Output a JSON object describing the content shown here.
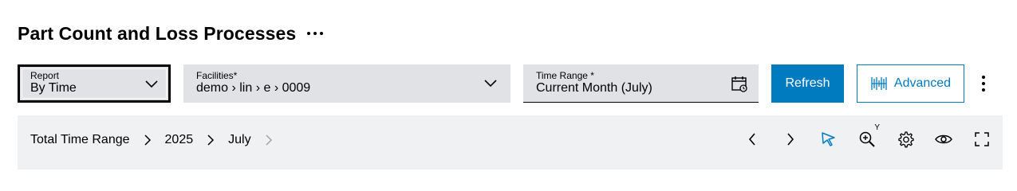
{
  "header": {
    "title": "Part Count and Loss Processes"
  },
  "filters": {
    "report": {
      "label": "Report",
      "value": "By Time"
    },
    "facilities": {
      "label": "Facilities*",
      "value": "demo › lin › e › 0009"
    },
    "time_range": {
      "label": "Time Range *",
      "value": "Current Month (July)"
    }
  },
  "actions": {
    "refresh_label": "Refresh",
    "advanced_label": "Advanced"
  },
  "breadcrumb": [
    "Total Time Range",
    "2025",
    "July"
  ],
  "toolbar": {
    "zoom_axis": "Y"
  },
  "colors": {
    "accent": "#007bc0",
    "field_bg": "#e0e2e5",
    "toolbar_bg": "#eff1f2"
  },
  "icons": [
    "more-horizontal-icon",
    "chevron-down-icon",
    "calendar-icon",
    "advanced-filter-icon",
    "more-vertical-icon",
    "chevron-right-icon",
    "chevron-left-icon",
    "cursor-select-icon",
    "zoom-icon",
    "gear-icon",
    "eye-icon",
    "fullscreen-icon"
  ]
}
